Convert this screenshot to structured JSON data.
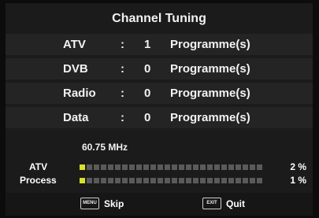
{
  "title": "Channel Tuning",
  "rows": [
    {
      "name": "ATV",
      "colon": ":",
      "count": "1",
      "unit": "Programme(s)"
    },
    {
      "name": "DVB",
      "colon": ":",
      "count": "0",
      "unit": "Programme(s)"
    },
    {
      "name": "Radio",
      "colon": ":",
      "count": "0",
      "unit": "Programme(s)"
    },
    {
      "name": "Data",
      "colon": ":",
      "count": "0",
      "unit": "Programme(s)"
    }
  ],
  "scan": {
    "frequency": "60.75 MHz",
    "atv_label": "ATV",
    "atv_percent": "2 %",
    "atv_progress": 0.02,
    "process_label": "Process",
    "process_percent": "1 %",
    "process_progress": 0.01
  },
  "footer": {
    "skip_key": "MENU",
    "skip_label": "Skip",
    "quit_key": "EXIT",
    "quit_label": "Quit"
  },
  "colors": {
    "progress_on": "#d8e02a",
    "progress_off": "#5a5a5a"
  }
}
